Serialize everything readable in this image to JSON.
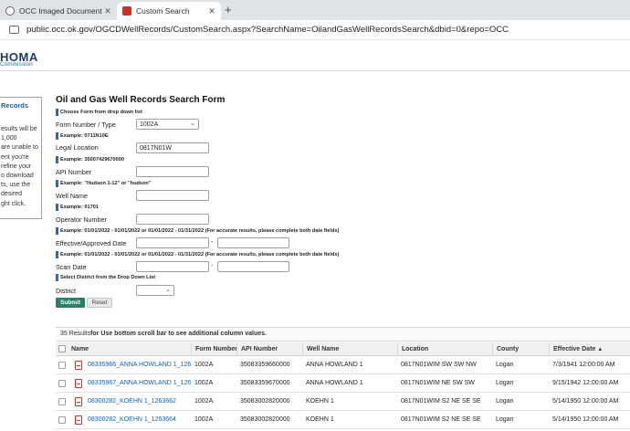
{
  "browser": {
    "tabs": [
      {
        "title": "OCC Imaged Documents Dire",
        "active": false
      },
      {
        "title": "Custom Search",
        "active": true
      }
    ],
    "new_tab_glyph": "+",
    "url": "public.occ.ok.gov/OGCDWellRecords/CustomSearch.aspx?SearchName=OilandGasWellRecordsSearch&dbid=0&repo=OCC"
  },
  "header": {
    "logo_main": "HOMA",
    "logo_sub": "Commission"
  },
  "left_panel": {
    "title": "Records",
    "lines": [
      "esults will be",
      "1,000",
      "are unable to",
      "ent you're",
      "refine your",
      "o download",
      "ts, use the",
      "desired",
      "ght click."
    ]
  },
  "form": {
    "title": "Oil and Gas Well Records Search Form",
    "notes": {
      "choose_form": "Choose Form from drop down list",
      "legal_example": "Example: 0711N10E",
      "api_example": "Example: 35007429670000",
      "well_example": "Example: \"Hudson 1-12\" or \"hudson\"",
      "operator_example": "Example: 01701",
      "date_example_1": "Example: 01/01/2022 - 01/01/2022 or 01/01/2022 - 01/31/2022 (For accurate results, please complete both date fields)",
      "date_example_2": "Example: 01/01/2022 - 01/01/2022 or 01/01/2022 - 01/31/2022 (For accurate results, please complete both date fields)",
      "district_note": "Select District from the Drop Down List"
    },
    "labels": {
      "form_number": "Form Number / Type",
      "legal_location": "Legal Location",
      "api_number": "API Number",
      "well_name": "Well Name",
      "operator_number": "Operator Number",
      "effective_date": "Effective/Approved Date",
      "scan_date": "Scan Date",
      "district": "District"
    },
    "values": {
      "form_number": "1002A",
      "legal_location": "0817N01W",
      "api_number": "",
      "well_name": "",
      "operator_number": "",
      "effective_from": "",
      "effective_to": "",
      "scan_from": "",
      "scan_to": "",
      "district": ""
    },
    "range_separator": "-",
    "submit_label": "Submit",
    "reset_label": "Reset"
  },
  "results": {
    "count_text": "35 Results",
    "hint_text": "for Use bottom scroll bar to see additional column values.",
    "columns": [
      "Name",
      "Form Number",
      "API Number",
      "Well Name",
      "Location",
      "County",
      "Effective Date"
    ],
    "sort_glyph": "▲",
    "rows": [
      {
        "name": "08335966_ANNA HOWLAND 1_126...",
        "form": "1002A",
        "api": "35083359660000",
        "well": "ANNA HOWLAND 1",
        "location": "0817N01WIM SW SW NW",
        "county": "Logan",
        "date": "7/3/1941 12:00:00 AM"
      },
      {
        "name": "08335967_ANNA HOWLAND 1_126...",
        "form": "1002A",
        "api": "35083359670000",
        "well": "ANNA HOWLAND 1",
        "location": "0817N01WIM NE SW SW",
        "county": "Logan",
        "date": "9/15/1942 12:00:00 AM"
      },
      {
        "name": "08300282_KOEHN 1_1263662",
        "form": "1002A",
        "api": "35083002820000",
        "well": "KOEHN 1",
        "location": "0817N01WIM S2 NE SE SE",
        "county": "Logan",
        "date": "5/14/1950 12:00:00 AM"
      },
      {
        "name": "08300282_KOEHN 1_1263664",
        "form": "1002A",
        "api": "35083002820000",
        "well": "KOEHN 1",
        "location": "0817N01WIM S2 NE SE SE",
        "county": "Logan",
        "date": "5/14/1950 12:00:00 AM"
      }
    ]
  }
}
